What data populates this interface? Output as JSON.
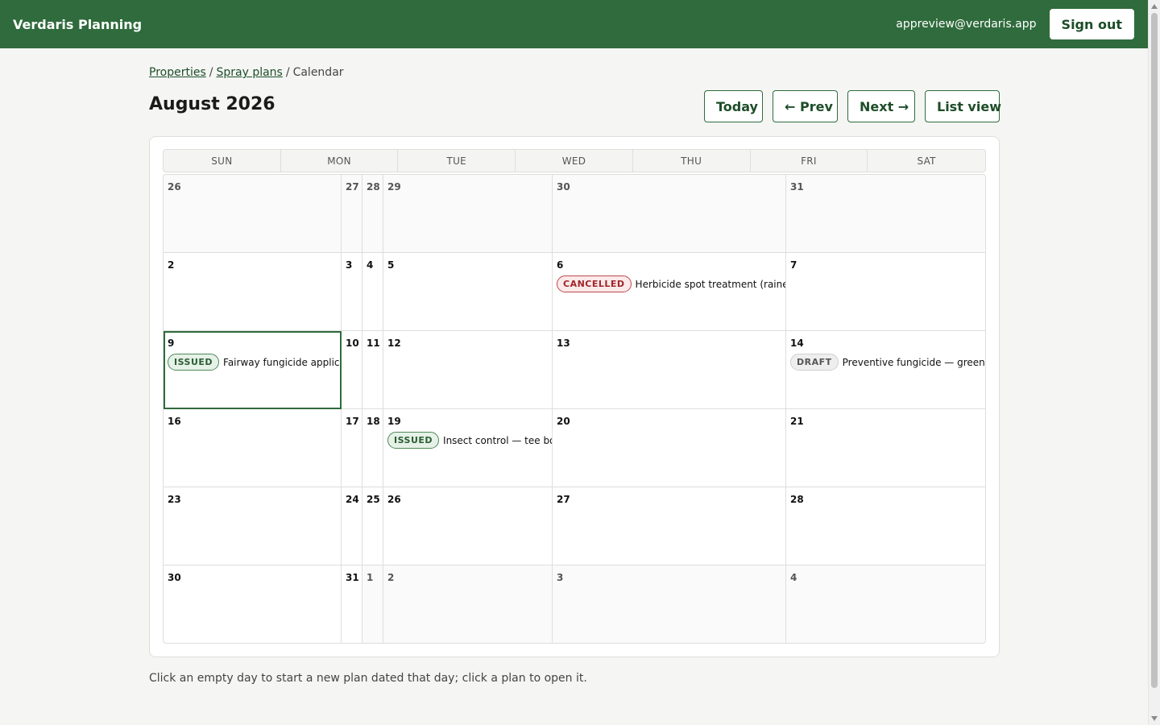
{
  "app": {
    "brand": "Verdaris Planning",
    "user_email": "appreview@verdaris.app",
    "signout_label": "Sign out"
  },
  "breadcrumb": {
    "properties": "Properties",
    "spray_plans": "Spray plans",
    "current": "Calendar",
    "separator": "/"
  },
  "header": {
    "title": "August 2026"
  },
  "actions": {
    "today": "Today",
    "prev": "← Prev",
    "next": "Next →",
    "list_view": "List view"
  },
  "weekdays": [
    "SUN",
    "MON",
    "TUE",
    "WED",
    "THU",
    "FRI",
    "SAT"
  ],
  "calendar": {
    "weeks": [
      {
        "days": [
          {
            "day": "26",
            "outside": true
          },
          {
            "day": "27",
            "outside": true
          },
          {
            "day": "28",
            "outside": true
          },
          {
            "day": "29",
            "outside": true
          },
          {
            "day": "30",
            "outside": true
          },
          {
            "day": "31",
            "outside": true
          }
        ]
      },
      {
        "days": [
          {
            "day": "2"
          },
          {
            "day": "3"
          },
          {
            "day": "4"
          },
          {
            "day": "5"
          },
          {
            "day": "6",
            "plan": {
              "status": "CANCELLED",
              "kind": "cancelled",
              "title": "Herbicide spot treatment (rained out)"
            }
          },
          {
            "day": "7"
          }
        ]
      },
      {
        "days": [
          {
            "day": "9",
            "today": true,
            "plan": {
              "status": "ISSUED",
              "kind": "issued",
              "title": "Fairway fungicide application"
            }
          },
          {
            "day": "10"
          },
          {
            "day": "11"
          },
          {
            "day": "12"
          },
          {
            "day": "13"
          },
          {
            "day": "14",
            "plan": {
              "status": "DRAFT",
              "kind": "draft",
              "title": "Preventive fungicide — greens pack"
            }
          }
        ]
      },
      {
        "days": [
          {
            "day": "16"
          },
          {
            "day": "17"
          },
          {
            "day": "18"
          },
          {
            "day": "19",
            "plan": {
              "status": "ISSUED",
              "kind": "issued",
              "title": "Insect control — tee boxes"
            }
          },
          {
            "day": "20"
          },
          {
            "day": "21"
          }
        ]
      },
      {
        "days": [
          {
            "day": "23"
          },
          {
            "day": "24"
          },
          {
            "day": "25"
          },
          {
            "day": "26"
          },
          {
            "day": "27"
          },
          {
            "day": "28"
          }
        ]
      },
      {
        "days": [
          {
            "day": "30"
          },
          {
            "day": "31"
          },
          {
            "day": "1",
            "outside": true
          },
          {
            "day": "2",
            "outside": true
          },
          {
            "day": "3",
            "outside": true
          },
          {
            "day": "4",
            "outside": true
          }
        ]
      }
    ]
  },
  "footnote": "Click an empty day to start a new plan dated that day; click a plan to open it.",
  "colors": {
    "brand_green": "#2f6b3c",
    "issued": "#2a5d34",
    "cancelled": "#a0242a",
    "draft": "#555555"
  }
}
